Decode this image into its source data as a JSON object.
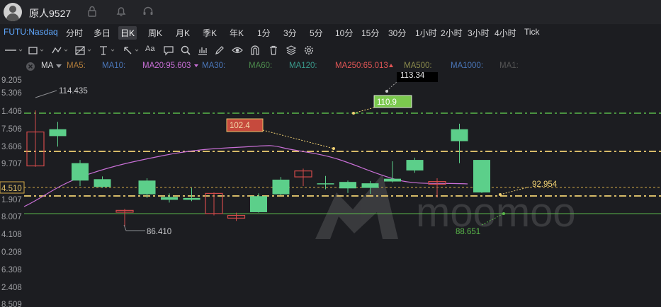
{
  "user": {
    "name": "原人9527"
  },
  "timeframes": {
    "symbol": "FUTU:Nasdaq",
    "items": [
      "分时",
      "多日",
      "日K",
      "周K",
      "月K",
      "季K",
      "年K",
      "1分",
      "3分",
      "5分",
      "10分",
      "15分",
      "30分",
      "1小时",
      "2小时",
      "3小时",
      "4小时",
      "Tick"
    ],
    "active": "日K"
  },
  "toolbar": {
    "text_tool": "Aa"
  },
  "ma_bar": {
    "label": "MA",
    "items": [
      {
        "text": "MA5:",
        "color": "#b07b3a"
      },
      {
        "text": "MA10:",
        "color": "#4a76b8"
      },
      {
        "text": "MA20:95.603",
        "color": "#c86fd6"
      },
      {
        "text": "MA30:",
        "color": "#4a76b8"
      },
      {
        "text": "MA60:",
        "color": "#4c8a4c"
      },
      {
        "text": "MA120:",
        "color": "#3a9a8c"
      },
      {
        "text": "MA250:65.013",
        "color": "#e05555"
      },
      {
        "text": "MA500:",
        "color": "#8a8a4c"
      },
      {
        "text": "MA1000:",
        "color": "#4a76b8"
      },
      {
        "text": "MA1:",
        "color": "#555"
      }
    ]
  },
  "chart_data": {
    "type": "candlestick",
    "y_axis_labels": [
      "9.205",
      "5.306",
      "1.406",
      "7.506",
      "3.606",
      "9.707",
      "4.510",
      "1.907",
      "8.007",
      "4.108",
      "0.208",
      "6.308",
      "2.408",
      "8.509"
    ],
    "current_price": "4.510",
    "annotations": {
      "high": "114.435",
      "low": "86.410",
      "top_partial": "113.34",
      "box_green": "110.9",
      "box_red": "102.4",
      "right_price": "92.954",
      "right_low": "88.651"
    },
    "watermark": "moomoo",
    "candles": [
      {
        "o": 106.8,
        "h": 111.5,
        "l": 99.2,
        "c": 99.4
      },
      {
        "o": 105.9,
        "h": 109.0,
        "l": 103.6,
        "c": 107.4
      },
      {
        "o": 96.2,
        "h": 100.7,
        "l": 95.0,
        "c": 100.0
      },
      {
        "o": 94.8,
        "h": 97.1,
        "l": 94.6,
        "c": 96.5
      },
      {
        "o": 89.7,
        "h": 90.0,
        "l": 86.2,
        "c": 89.3
      },
      {
        "o": 93.2,
        "h": 96.7,
        "l": 92.4,
        "c": 96.2
      },
      {
        "o": 92.0,
        "h": 93.4,
        "l": 91.4,
        "c": 92.6
      },
      {
        "o": 92.0,
        "h": 94.6,
        "l": 91.7,
        "c": 92.4
      },
      {
        "o": 93.4,
        "h": 93.6,
        "l": 88.6,
        "c": 89.0
      },
      {
        "o": 88.6,
        "h": 89.2,
        "l": 87.4,
        "c": 88.0
      },
      {
        "o": 89.3,
        "h": 93.4,
        "l": 89.2,
        "c": 92.8
      },
      {
        "o": 93.2,
        "h": 97.0,
        "l": 93.0,
        "c": 96.4
      },
      {
        "o": 98.3,
        "h": 98.8,
        "l": 95.0,
        "c": 97.0
      },
      {
        "o": 95.5,
        "h": 97.2,
        "l": 94.3,
        "c": 95.6
      },
      {
        "o": 94.5,
        "h": 96.2,
        "l": 93.5,
        "c": 95.9
      },
      {
        "o": 94.6,
        "h": 96.1,
        "l": 93.3,
        "c": 95.6
      },
      {
        "o": 96.0,
        "h": 100.4,
        "l": 95.8,
        "c": 96.6
      },
      {
        "o": 98.4,
        "h": 101.2,
        "l": 97.9,
        "c": 100.7
      },
      {
        "o": 96.0,
        "h": 96.7,
        "l": 92.5,
        "c": 95.4
      },
      {
        "o": 104.8,
        "h": 108.6,
        "l": 100.0,
        "c": 107.4
      },
      {
        "o": 93.6,
        "h": 100.6,
        "l": 93.5,
        "c": 100.7
      }
    ]
  }
}
